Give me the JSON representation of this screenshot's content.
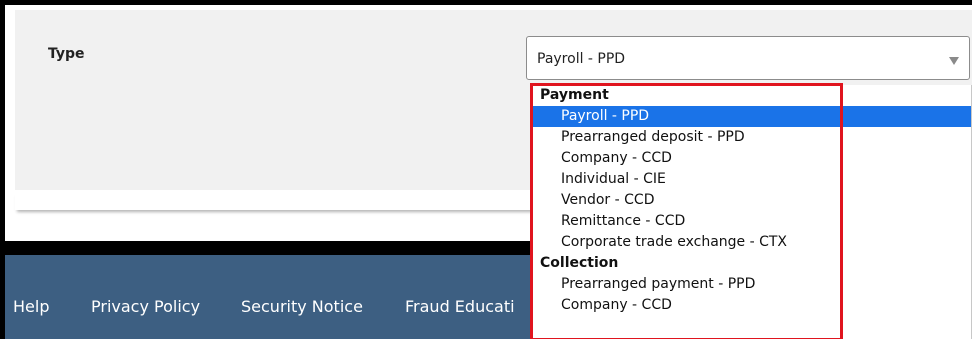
{
  "form": {
    "type_label": "Type",
    "selected_value": "Payroll - PPD",
    "arrow_icon": "dropdown-arrow-icon"
  },
  "dropdown": {
    "groups": [
      {
        "label": "Payment",
        "options": [
          "Payroll - PPD",
          "Prearranged deposit - PPD",
          "Company - CCD",
          "Individual - CIE",
          "Vendor - CCD",
          "Remittance - CCD",
          "Corporate trade exchange - CTX"
        ]
      },
      {
        "label": "Collection",
        "options": [
          "Prearranged payment - PPD",
          "Company - CCD"
        ]
      }
    ],
    "selected_option": "Payroll - PPD",
    "highlight_color": "#e0141e",
    "selected_bg": "#1a73e8"
  },
  "footer": {
    "links": [
      "Help",
      "Privacy Policy",
      "Security Notice",
      "Fraud Educati"
    ],
    "background": "#3d5f82"
  }
}
